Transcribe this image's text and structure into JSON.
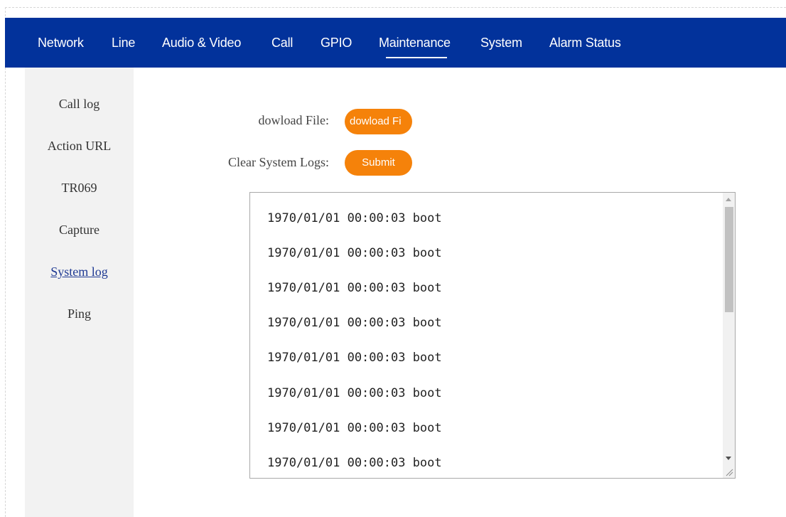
{
  "nav": {
    "items": [
      {
        "label": "Network"
      },
      {
        "label": "Line"
      },
      {
        "label": "Audio & Video"
      },
      {
        "label": "Call"
      },
      {
        "label": "GPIO"
      },
      {
        "label": "Maintenance"
      },
      {
        "label": "System"
      },
      {
        "label": "Alarm Status"
      }
    ],
    "active": "Maintenance"
  },
  "sidebar": {
    "items": [
      {
        "label": "Call log"
      },
      {
        "label": "Action URL"
      },
      {
        "label": "TR069"
      },
      {
        "label": "Capture"
      },
      {
        "label": "System log"
      },
      {
        "label": "Ping"
      }
    ],
    "active": "System log"
  },
  "form": {
    "download_label": "dowload File:",
    "download_button": "dowload Fi",
    "clear_label": "Clear System Logs:",
    "clear_button": "Submit"
  },
  "log": {
    "lines": [
      "1970/01/01 00:00:03 boot",
      "1970/01/01 00:00:03 boot",
      "1970/01/01 00:00:03 boot",
      "1970/01/01 00:00:03 boot",
      "1970/01/01 00:00:03 boot",
      "1970/01/01 00:00:03 boot",
      "1970/01/01 00:00:03 boot",
      "1970/01/01 00:00:03 boot"
    ]
  },
  "colors": {
    "nav_bg": "#02329b",
    "button_bg": "#f5820a",
    "sidebar_bg": "#f2f2f2",
    "active_link": "#1f3a93"
  }
}
